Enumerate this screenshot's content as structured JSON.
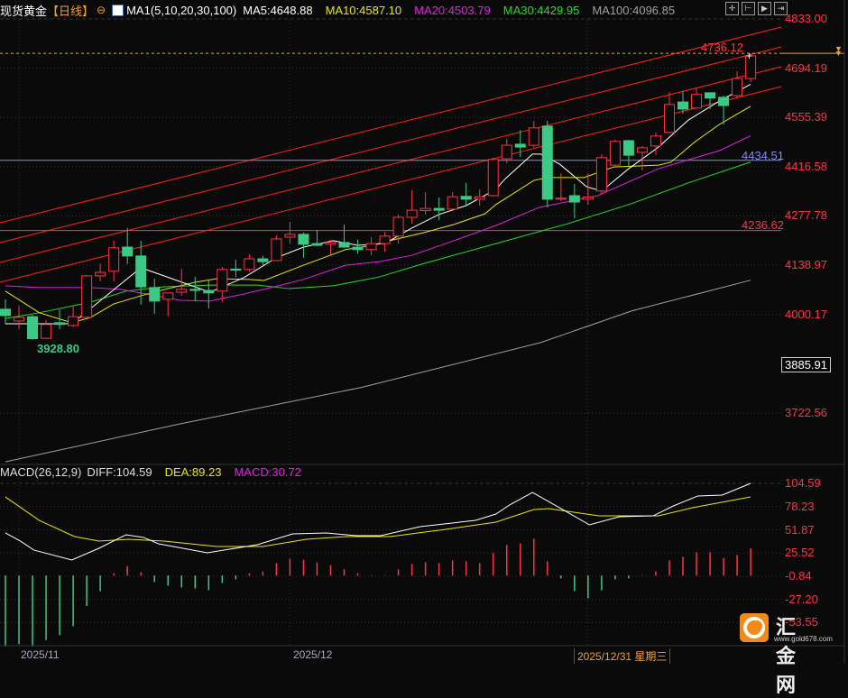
{
  "header": {
    "symbol": "现货黄金",
    "period": "【日线】",
    "ma_label": "MA1(5,10,20,30,100)",
    "ma5": "MA5:4648.88",
    "ma10": "MA10:4587.10",
    "ma20": "MA20:4503.79",
    "ma30": "MA30:4429.95",
    "ma100": "MA100:4096.85"
  },
  "toolbar": [
    "crosshair-icon",
    "zoom-range-icon",
    "play-forward-icon",
    "move-right-icon"
  ],
  "colors": {
    "up": "#ff3344",
    "down": "#3cc985",
    "ma5": "#ffffff",
    "ma10": "#e8e800",
    "ma20": "#e020e0",
    "ma30": "#22dd22",
    "ma100": "#a0a0a0",
    "dea": "#e8e800",
    "diff": "#ffffff",
    "bg": "#0a0a0a"
  },
  "price_axis": [
    "4833.00",
    "4694.19",
    "4555.39",
    "4416.58",
    "4277.78",
    "4138.97",
    "4000.17",
    "3722.56"
  ],
  "price_axis_values": [
    4833.0,
    4694.19,
    4555.39,
    4416.58,
    4277.78,
    4138.97,
    4000.17,
    3722.56
  ],
  "cursor_price": "3885.91",
  "last_price_label": "4736.12",
  "levels": [
    {
      "value": 4434.51,
      "label": "4434.51",
      "color": "#8888ee"
    },
    {
      "value": 4236.62,
      "label": "4236.62",
      "color": "#ff3344"
    }
  ],
  "low_label": "3928.80",
  "macd_header": {
    "name": "MACD(26,12,9)",
    "diff": "DIFF:104.59",
    "dea": "DEA:89.23",
    "macd": "MACD:30.72"
  },
  "macd_axis": [
    "104.59",
    "78.23",
    "51.87",
    "25.52",
    "-0.84",
    "-27.20",
    "-53.55"
  ],
  "macd_axis_values": [
    104.59,
    78.23,
    51.87,
    25.52,
    -0.84,
    -27.2,
    -53.55
  ],
  "x_axis": {
    "labels": [
      {
        "text": "2025/11",
        "index": 1
      },
      {
        "text": "2025/12",
        "index": 21
      }
    ],
    "cursor": "2025/12/31 星期三"
  },
  "watermark": {
    "brand": "汇金网",
    "url": "www.gold678.com"
  },
  "chart_data": {
    "type": "candlestick",
    "ohlc": [
      [
        4015,
        4043,
        3972,
        3997
      ],
      [
        3982,
        4025,
        3959,
        3992
      ],
      [
        3994,
        3999,
        3928.8,
        3932
      ],
      [
        3933,
        3984,
        3930,
        3972
      ],
      [
        3977,
        4014,
        3959,
        3972
      ],
      [
        3969,
        4025,
        3965,
        3994
      ],
      [
        3992,
        4111,
        3990,
        4109
      ],
      [
        4109,
        4144,
        4094,
        4119
      ],
      [
        4122,
        4208,
        4094,
        4188
      ],
      [
        4190,
        4244,
        4142,
        4165
      ],
      [
        4165,
        4208,
        4028,
        4078
      ],
      [
        4076,
        4101,
        4002,
        4038
      ],
      [
        4043,
        4062,
        3995,
        4061
      ],
      [
        4063,
        4129,
        4053,
        4071
      ],
      [
        4071,
        4106,
        4038,
        4068
      ],
      [
        4068,
        4099,
        4017,
        4061
      ],
      [
        4066,
        4134,
        4035,
        4127
      ],
      [
        4128,
        4155,
        4106,
        4125
      ],
      [
        4127,
        4170,
        4121,
        4157
      ],
      [
        4157,
        4165,
        4139,
        4149
      ],
      [
        4152,
        4223,
        4150,
        4213
      ],
      [
        4218,
        4261,
        4200,
        4226
      ],
      [
        4226,
        4231,
        4160,
        4198
      ],
      [
        4200,
        4238,
        4193,
        4195
      ],
      [
        4198,
        4211,
        4170,
        4203
      ],
      [
        4203,
        4254,
        4188,
        4190
      ],
      [
        4190,
        4211,
        4172,
        4183
      ],
      [
        4183,
        4218,
        4167,
        4200
      ],
      [
        4200,
        4233,
        4177,
        4221
      ],
      [
        4221,
        4282,
        4200,
        4274
      ],
      [
        4274,
        4350,
        4256,
        4294
      ],
      [
        4293,
        4345,
        4282,
        4299
      ],
      [
        4299,
        4330,
        4266,
        4294
      ],
      [
        4297,
        4345,
        4295,
        4332
      ],
      [
        4333,
        4371,
        4307,
        4325
      ],
      [
        4325,
        4353,
        4307,
        4332
      ],
      [
        4335,
        4442,
        4332,
        4437
      ],
      [
        4439,
        4495,
        4426,
        4477
      ],
      [
        4480,
        4520,
        4444,
        4472
      ],
      [
        4477,
        4546,
        4470,
        4526
      ],
      [
        4531,
        4546,
        4302,
        4325
      ],
      [
        4325,
        4398,
        4320,
        4328
      ],
      [
        4335,
        4368,
        4271,
        4317
      ],
      [
        4325,
        4398,
        4310,
        4331
      ],
      [
        4348,
        4452,
        4340,
        4442
      ],
      [
        4421,
        4493,
        4418,
        4488
      ],
      [
        4490,
        4492,
        4419,
        4449
      ],
      [
        4457,
        4475,
        4406,
        4470
      ],
      [
        4475,
        4513,
        4449,
        4503
      ],
      [
        4513,
        4627,
        4510,
        4592
      ],
      [
        4599,
        4630,
        4566,
        4579
      ],
      [
        4582,
        4637,
        4580,
        4620
      ],
      [
        4625,
        4625,
        4579,
        4610
      ],
      [
        4612,
        4617,
        4536,
        4589
      ],
      [
        4617,
        4686,
        4612,
        4665
      ],
      [
        4665,
        4736.12,
        4655,
        4729
      ]
    ],
    "ma": {
      "ma5": [
        [
          0,
          3974
        ],
        [
          4.9,
          3974
        ],
        [
          10,
          4132
        ],
        [
          15.1,
          4063
        ],
        [
          17.6,
          4104
        ],
        [
          20,
          4160
        ],
        [
          22,
          4190
        ],
        [
          24.2,
          4208
        ],
        [
          26,
          4195
        ],
        [
          28,
          4200
        ],
        [
          30,
          4244
        ],
        [
          32,
          4282
        ],
        [
          34,
          4307
        ],
        [
          36.2,
          4353
        ],
        [
          36.9,
          4383
        ],
        [
          38.9,
          4452
        ],
        [
          39.5,
          4452
        ],
        [
          40.9,
          4424
        ],
        [
          42.9,
          4360
        ],
        [
          44,
          4348
        ],
        [
          46,
          4411
        ],
        [
          48.2,
          4472
        ],
        [
          50.4,
          4548
        ],
        [
          52.7,
          4602
        ],
        [
          55,
          4648.88
        ]
      ],
      "ma10": [
        [
          0,
          4066
        ],
        [
          2.5,
          4005
        ],
        [
          4.9,
          3977
        ],
        [
          6.3,
          3992
        ],
        [
          8,
          4030
        ],
        [
          10,
          4053
        ],
        [
          12,
          4073
        ],
        [
          14,
          4091
        ],
        [
          15.6,
          4101
        ],
        [
          18,
          4099
        ],
        [
          19.1,
          4096
        ],
        [
          22,
          4139
        ],
        [
          25.1,
          4183
        ],
        [
          27.1,
          4195
        ],
        [
          28,
          4205
        ],
        [
          30.9,
          4231
        ],
        [
          33.1,
          4254
        ],
        [
          35.4,
          4284
        ],
        [
          36.2,
          4310
        ],
        [
          39,
          4378
        ],
        [
          40,
          4386
        ],
        [
          42.7,
          4386
        ],
        [
          44.9,
          4416
        ],
        [
          48.2,
          4421
        ],
        [
          49.1,
          4429
        ],
        [
          50.9,
          4487
        ],
        [
          52.7,
          4536
        ],
        [
          55,
          4587.1
        ]
      ],
      "ma20": [
        [
          0,
          4081
        ],
        [
          2.5,
          4076
        ],
        [
          6.3,
          4076
        ],
        [
          8.5,
          4071
        ],
        [
          10.7,
          4056
        ],
        [
          12.9,
          4040
        ],
        [
          15.1,
          4038
        ],
        [
          17.6,
          4058
        ],
        [
          19.8,
          4078
        ],
        [
          22,
          4099
        ],
        [
          25.1,
          4139
        ],
        [
          27.6,
          4149
        ],
        [
          30,
          4167
        ],
        [
          33.1,
          4208
        ],
        [
          36.2,
          4251
        ],
        [
          39.4,
          4302
        ],
        [
          43.7,
          4335
        ],
        [
          48.2,
          4411
        ],
        [
          52.7,
          4462
        ],
        [
          55,
          4503.79
        ]
      ],
      "ma30": [
        [
          0,
          3989
        ],
        [
          2.5,
          4005
        ],
        [
          6.3,
          4035
        ],
        [
          8.9,
          4066
        ],
        [
          11.6,
          4078
        ],
        [
          15.1,
          4083
        ],
        [
          18.6,
          4083
        ],
        [
          20.9,
          4073
        ],
        [
          24.2,
          4081
        ],
        [
          27.6,
          4106
        ],
        [
          30.9,
          4144
        ],
        [
          36.2,
          4200
        ],
        [
          41.5,
          4256
        ],
        [
          46,
          4310
        ],
        [
          50.4,
          4371
        ],
        [
          55,
          4429.95
        ]
      ],
      "ma100": [
        [
          0,
          3585
        ],
        [
          12.9,
          3692
        ],
        [
          26.2,
          3794
        ],
        [
          39.5,
          3921
        ],
        [
          46.2,
          4010
        ],
        [
          55,
          4096.85
        ]
      ]
    },
    "macd": {
      "hist": [
        -80.5,
        -77.8,
        -80.5,
        -73.2,
        -67.7,
        -57.5,
        -34.7,
        -17.9,
        2.6,
        10.7,
        3.6,
        -7.4,
        -11.5,
        -13.5,
        -14.6,
        -16.6,
        -8.4,
        -4.3,
        2.6,
        4.6,
        14.0,
        19.0,
        17.9,
        14.8,
        11.8,
        7.0,
        2.6,
        0.5,
        0.5,
        7.0,
        13.1,
        15.1,
        14.1,
        17.2,
        16.2,
        14.1,
        25.4,
        34.6,
        36.6,
        41.8,
        16.2,
        -3.3,
        -17.6,
        -25.8,
        -16.6,
        -4.3,
        -3.3,
        0.5,
        4.6,
        17.2,
        21.3,
        26.4,
        26.4,
        20.0,
        23.3,
        30.72
      ],
      "diff": [
        [
          0,
          48.3
        ],
        [
          1.1,
          39.1
        ],
        [
          2.1,
          28.9
        ],
        [
          4.9,
          17.6
        ],
        [
          6.9,
          30.9
        ],
        [
          8.9,
          46.2
        ],
        [
          10.2,
          43.2
        ],
        [
          11.3,
          36.0
        ],
        [
          14.9,
          25.8
        ],
        [
          18.6,
          35.0
        ],
        [
          21.2,
          47.3
        ],
        [
          23.7,
          48.3
        ],
        [
          25.9,
          45.2
        ],
        [
          27.7,
          45.2
        ],
        [
          30.6,
          55.5
        ],
        [
          34.7,
          62.6
        ],
        [
          36.2,
          69.8
        ],
        [
          37.2,
          80.0
        ],
        [
          38.9,
          94.3
        ],
        [
          40.9,
          76.9
        ],
        [
          43.1,
          57.5
        ],
        [
          45.3,
          66.7
        ],
        [
          47.8,
          67.7
        ],
        [
          49.3,
          79.0
        ],
        [
          51.1,
          90.3
        ],
        [
          52.9,
          91.3
        ],
        [
          55,
          104.59
        ]
      ],
      "dea": [
        [
          0,
          89.2
        ],
        [
          2.5,
          62.6
        ],
        [
          5.1,
          44.2
        ],
        [
          6.9,
          39.1
        ],
        [
          9.1,
          41.1
        ],
        [
          11.7,
          39.1
        ],
        [
          15.6,
          33.0
        ],
        [
          19,
          33.0
        ],
        [
          22.2,
          41.1
        ],
        [
          25.2,
          44.2
        ],
        [
          28.4,
          44.2
        ],
        [
          32.5,
          52.4
        ],
        [
          36.2,
          60.6
        ],
        [
          39,
          74.9
        ],
        [
          40.1,
          75.9
        ],
        [
          43.8,
          67.7
        ],
        [
          48.2,
          67.7
        ],
        [
          50.7,
          76.9
        ],
        [
          55,
          89.23
        ]
      ]
    },
    "ylim": [
      3640,
      4870
    ],
    "macd_ylim": [
      -80,
      110
    ]
  }
}
